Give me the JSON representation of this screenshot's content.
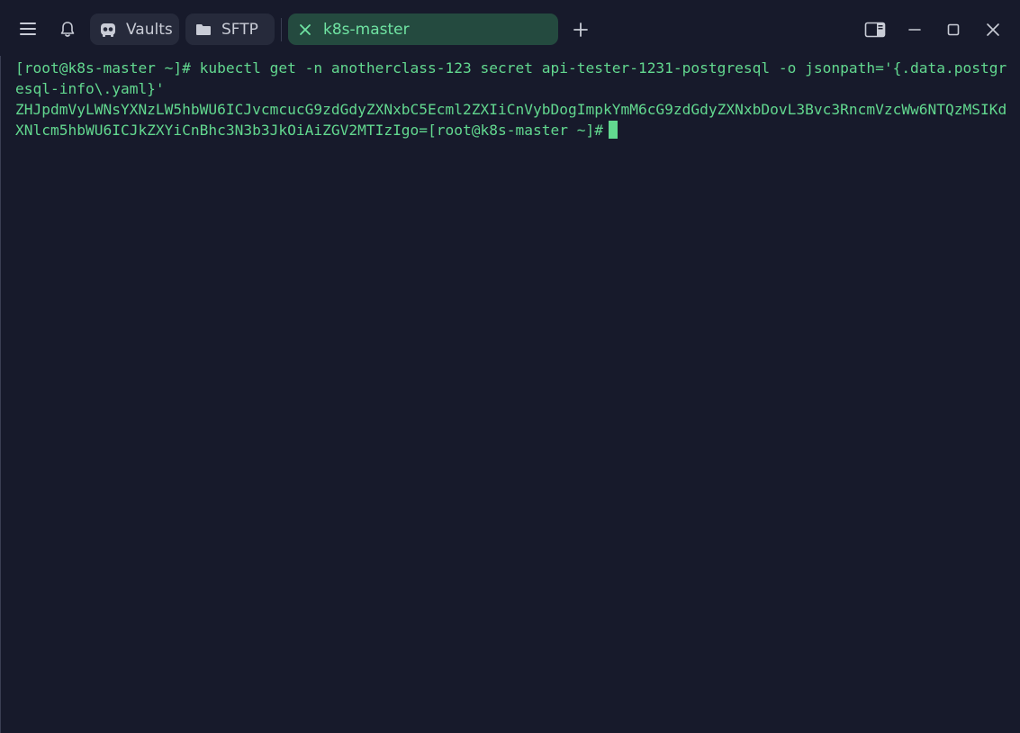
{
  "tabs": {
    "vaults_label": "Vaults",
    "sftp_label": "SFTP",
    "active_label": "k8s-master"
  },
  "icons": {
    "menu": "hamburger-menu-icon",
    "notifications": "bell-icon",
    "vaults": "vault-icon",
    "sftp": "folder-icon",
    "close_tab": "close-icon",
    "add_tab": "plus-icon",
    "split": "split-view-icon",
    "minimize": "minimize-icon",
    "maximize": "maximize-icon",
    "close_window": "close-icon"
  },
  "colors": {
    "background": "#171a2b",
    "terminal_text": "#62d88f",
    "active_tab_bg": "#244a3f",
    "pill_bg": "#262a3b"
  },
  "terminal": {
    "command_line": "[root@k8s-master ~]# kubectl get -n anotherclass-123 secret api-tester-1231-postgresql -o jsonpath='{.data.postgresql-info\\.yaml}'",
    "output": "ZHJpdmVyLWNsYXNzLW5hbWU6ICJvcmcucG9zdGdyZXNxbC5Ecml2ZXIiCnVybDogImpkYmM6cG9zdGdyZXNxbDovL3Bvc3RncmVzcWw6NTQzMSIKdXNlcm5hbWU6ICJkZXYiCnBhc3N3b3JkOiAiZGV2MTIzIgo=",
    "prompt": "[root@k8s-master ~]#"
  }
}
